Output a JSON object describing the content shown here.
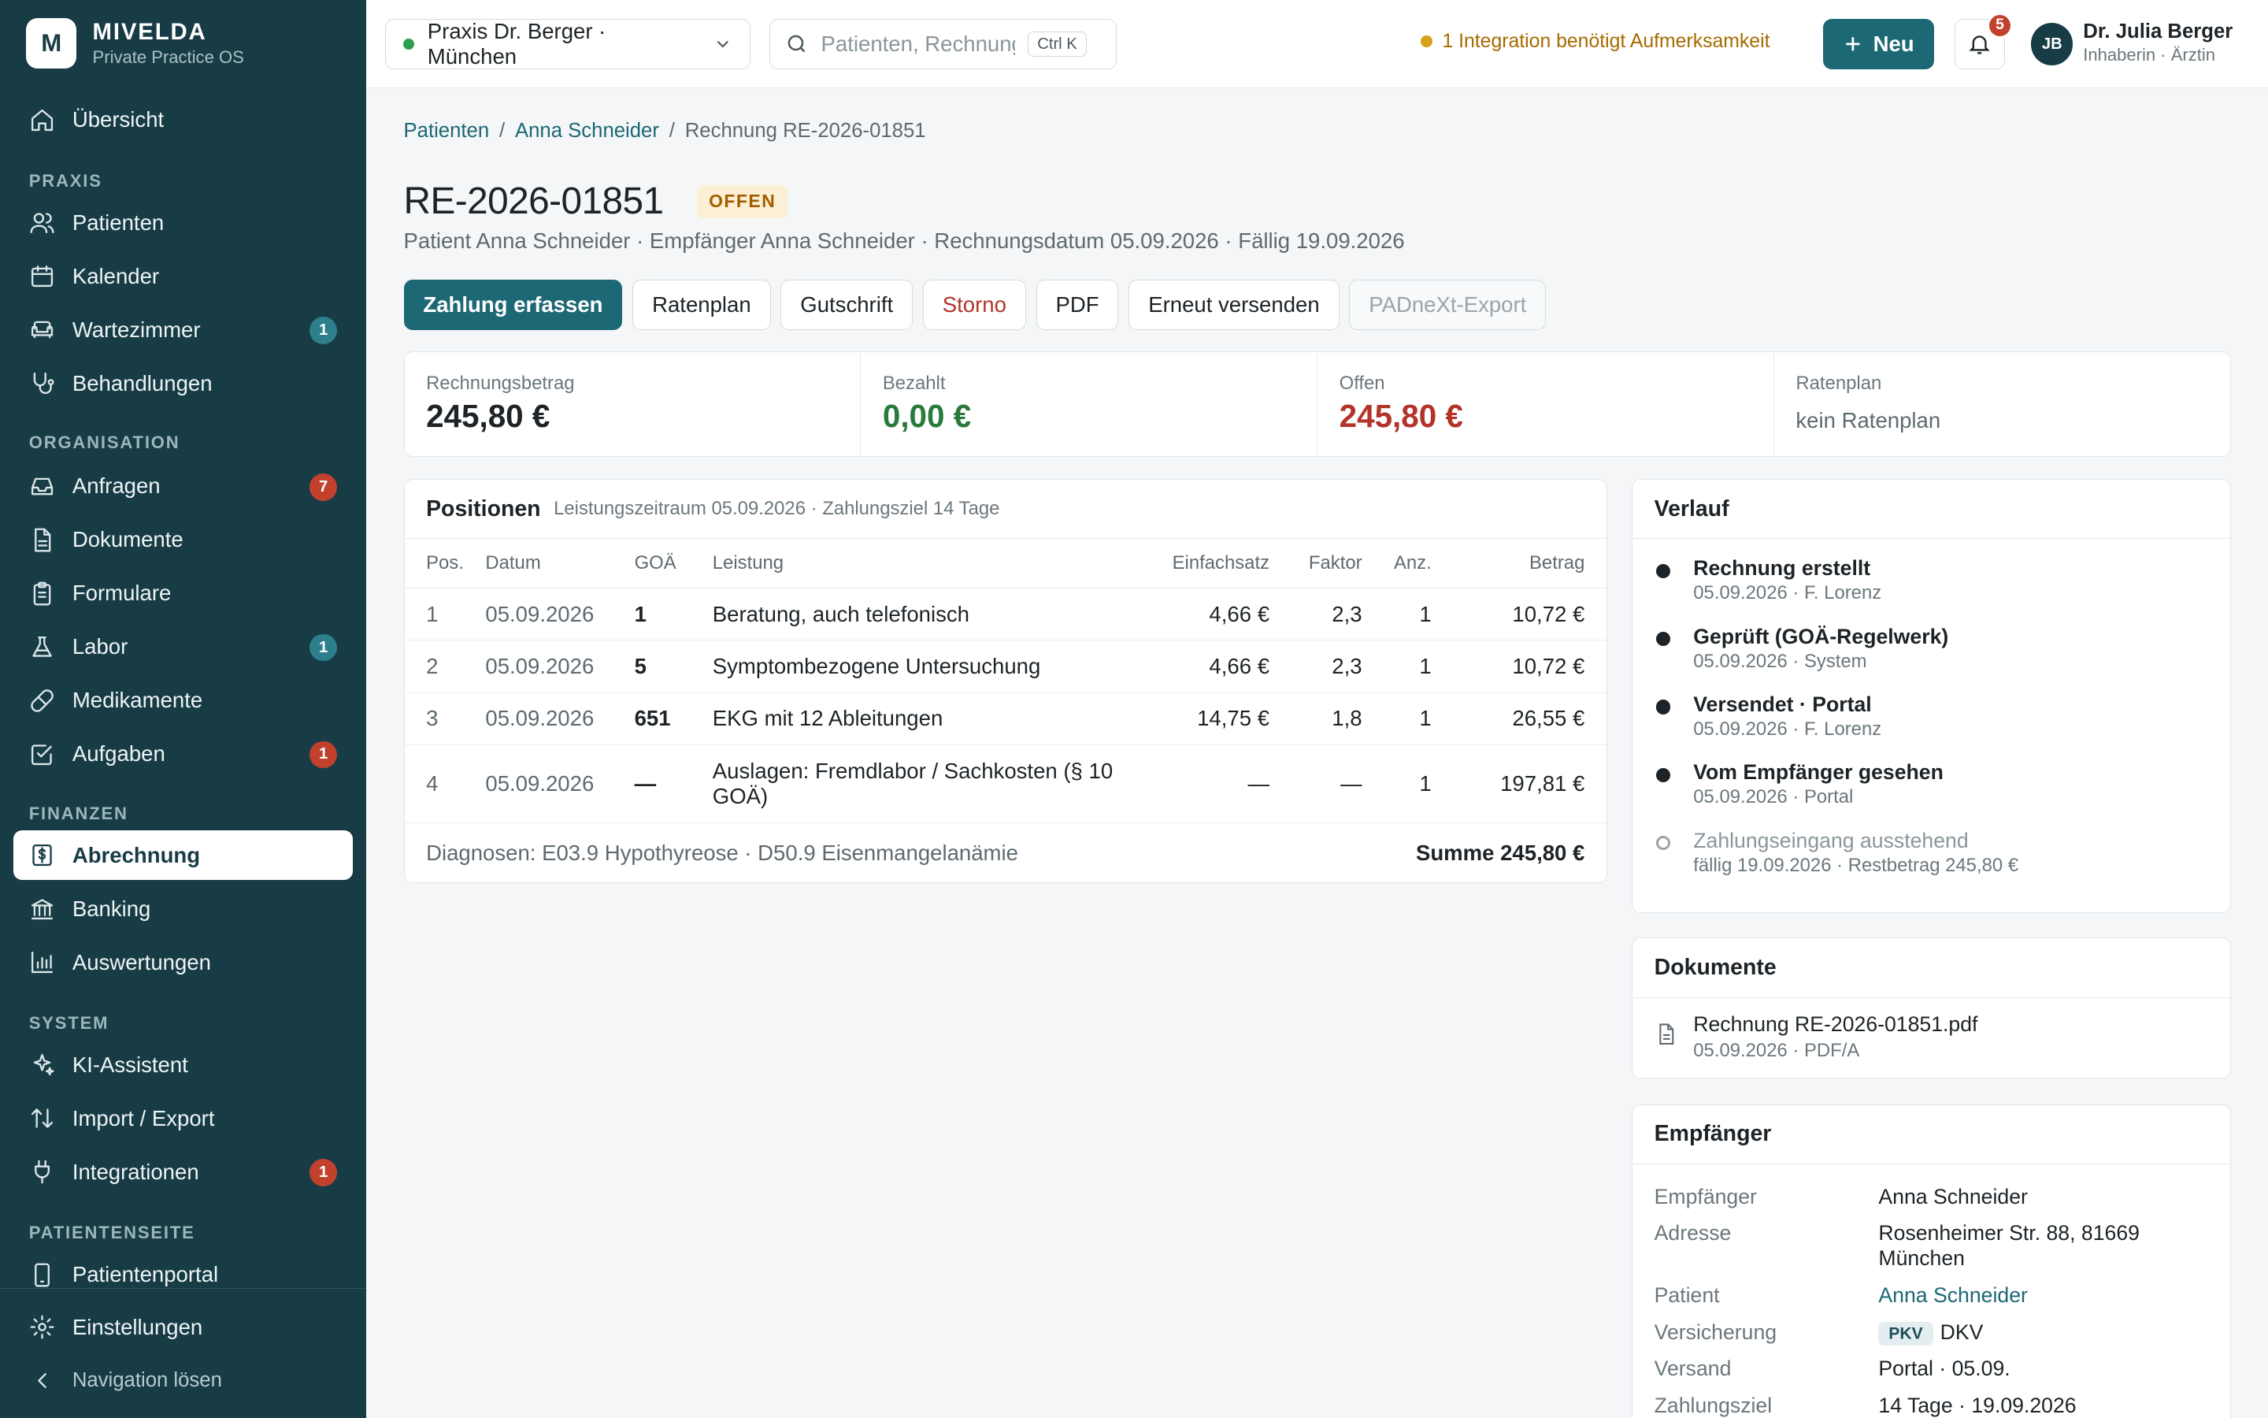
{
  "brand": {
    "initial": "M",
    "name": "MIVELDA",
    "tagline": "Private Practice OS"
  },
  "sidebar": {
    "overview": "Übersicht",
    "sections": {
      "praxis": "PRAXIS",
      "organisation": "ORGANISATION",
      "finanzen": "FINANZEN",
      "system": "SYSTEM",
      "patientenseite": "PATIENTENSEITE"
    },
    "items": {
      "patienten": {
        "label": "Patienten"
      },
      "kalender": {
        "label": "Kalender"
      },
      "wartezimmer": {
        "label": "Wartezimmer",
        "badge": "1"
      },
      "behandlungen": {
        "label": "Behandlungen"
      },
      "anfragen": {
        "label": "Anfragen",
        "badge": "7"
      },
      "dokumente": {
        "label": "Dokumente"
      },
      "formulare": {
        "label": "Formulare"
      },
      "labor": {
        "label": "Labor",
        "badge": "1"
      },
      "medikamente": {
        "label": "Medikamente"
      },
      "aufgaben": {
        "label": "Aufgaben",
        "badge": "1"
      },
      "abrechnung": {
        "label": "Abrechnung"
      },
      "banking": {
        "label": "Banking"
      },
      "auswertungen": {
        "label": "Auswertungen"
      },
      "ki": {
        "label": "KI-Assistent"
      },
      "import": {
        "label": "Import / Export"
      },
      "integrationen": {
        "label": "Integrationen",
        "badge": "1"
      },
      "portal": {
        "label": "Patientenportal"
      }
    },
    "settings": "Einstellungen",
    "collapse": "Navigation lösen"
  },
  "topbar": {
    "practice": "Praxis Dr. Berger · München",
    "search_placeholder": "Patienten, Rechnungen…",
    "search_shortcut": "Ctrl K",
    "integration_warning": "1 Integration benötigt Aufmerksamkeit",
    "new_label": "Neu",
    "notifications": "5",
    "user": {
      "initials": "JB",
      "name": "Dr. Julia Berger",
      "role": "Inhaberin · Ärztin"
    }
  },
  "breadcrumb": {
    "root": "Patienten",
    "patient": "Anna Schneider",
    "current": "Rechnung RE-2026-01851",
    "sep": "/"
  },
  "invoice": {
    "number": "RE-2026-01851",
    "status": "OFFEN",
    "meta": "Patient Anna Schneider · Empfänger Anna Schneider · Rechnungsdatum 05.09.2026 · Fällig 19.09.2026"
  },
  "actions": {
    "pay": "Zahlung erfassen",
    "plan": "Ratenplan",
    "credit": "Gutschrift",
    "cancel": "Storno",
    "pdf": "PDF",
    "resend": "Erneut versenden",
    "export": "PADneXt-Export"
  },
  "kpis": {
    "amount": {
      "label": "Rechnungsbetrag",
      "value": "245,80 €"
    },
    "paid": {
      "label": "Bezahlt",
      "value": "0,00 €"
    },
    "open": {
      "label": "Offen",
      "value": "245,80 €"
    },
    "plan": {
      "label": "Ratenplan",
      "value": "kein Ratenplan"
    }
  },
  "positions": {
    "title": "Positionen",
    "subtitle": "Leistungszeitraum 05.09.2026 · Zahlungsziel 14 Tage",
    "headers": {
      "pos": "Pos.",
      "date": "Datum",
      "goa": "GOÄ",
      "service": "Leistung",
      "base": "Einfachsatz",
      "factor": "Faktor",
      "qty": "Anz.",
      "amount": "Betrag"
    },
    "rows": [
      {
        "pos": "1",
        "date": "05.09.2026",
        "goa": "1",
        "service": "Beratung, auch telefonisch",
        "base": "4,66 €",
        "factor": "2,3",
        "qty": "1",
        "amount": "10,72 €"
      },
      {
        "pos": "2",
        "date": "05.09.2026",
        "goa": "5",
        "service": "Symptombezogene Untersuchung",
        "base": "4,66 €",
        "factor": "2,3",
        "qty": "1",
        "amount": "10,72 €"
      },
      {
        "pos": "3",
        "date": "05.09.2026",
        "goa": "651",
        "service": "EKG mit 12 Ableitungen",
        "base": "14,75 €",
        "factor": "1,8",
        "qty": "1",
        "amount": "26,55 €"
      },
      {
        "pos": "4",
        "date": "05.09.2026",
        "goa": "—",
        "service": "Auslagen: Fremdlabor / Sachkosten (§ 10 GOÄ)",
        "base": "—",
        "factor": "—",
        "qty": "1",
        "amount": "197,81 €"
      }
    ],
    "diagnoses": "Diagnosen: E03.9 Hypothyreose · D50.9 Eisenmangelanämie",
    "total": "Summe 245,80 €"
  },
  "history": {
    "title": "Verlauf",
    "items": [
      {
        "title": "Rechnung erstellt",
        "sub": "05.09.2026 · F. Lorenz"
      },
      {
        "title": "Geprüft (GOÄ-Regelwerk)",
        "sub": "05.09.2026 · System"
      },
      {
        "title": "Versendet · Portal",
        "sub": "05.09.2026 · F. Lorenz"
      },
      {
        "title": "Vom Empfänger gesehen",
        "sub": "05.09.2026 · Portal"
      },
      {
        "title": "Zahlungseingang ausstehend",
        "sub": "fällig 19.09.2026 · Restbetrag 245,80 €"
      }
    ]
  },
  "documents": {
    "title": "Dokumente",
    "file": {
      "name": "Rechnung RE-2026-01851.pdf",
      "sub": "05.09.2026 · PDF/A"
    }
  },
  "recipient": {
    "title": "Empfänger",
    "recipient_key": "Empfänger",
    "recipient_val": "Anna Schneider",
    "address_key": "Adresse",
    "address_val": "Rosenheimer Str. 88, 81669 München",
    "patient_key": "Patient",
    "patient_val": "Anna Schneider",
    "insurance_key": "Versicherung",
    "insurance_tag": "PKV",
    "insurance_val": "DKV",
    "shipping_key": "Versand",
    "shipping_val": "Portal · 05.09.",
    "terms_key": "Zahlungsziel",
    "terms_val": "14 Tage · 19.09.2026"
  }
}
